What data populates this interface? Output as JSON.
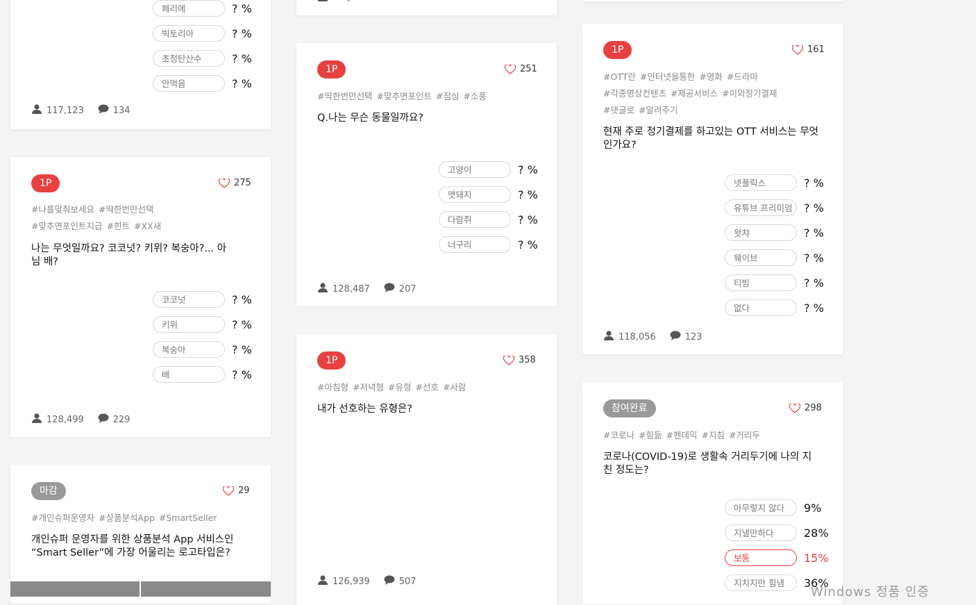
{
  "card1": {
    "options": [
      {
        "label": "페리에",
        "pct": "? %"
      },
      {
        "label": "빅토리아",
        "pct": "? %"
      },
      {
        "label": "초정탄산수",
        "pct": "? %"
      },
      {
        "label": "안먹음",
        "pct": "? %"
      }
    ],
    "participants": "117,123",
    "comments": "134"
  },
  "card2": {
    "badge": "1P",
    "likes": "275",
    "tags": [
      "#나를맞춰보세요",
      "#딱한번만선택",
      "#맞추면포인트지급",
      "#힌트",
      "#XX새"
    ],
    "question": "나는 무엇일까요? 코코넛? 키위? 복숭아?... 아님 배?",
    "options": [
      {
        "label": "코코넛",
        "pct": "? %"
      },
      {
        "label": "키위",
        "pct": "? %"
      },
      {
        "label": "복숭아",
        "pct": "? %"
      },
      {
        "label": "배",
        "pct": "? %"
      }
    ],
    "participants": "128,499",
    "comments": "229"
  },
  "card3": {
    "badge": "마감",
    "likes": "29",
    "tags": [
      "#개인슈퍼운영자",
      "#상품분석App",
      "#SmartSeller"
    ],
    "question": "개인슈퍼 운영자를 위한 상품분석 App 서비스인 “Smart Seller”에 가장 어울리는 로고타입은?"
  },
  "card4": {
    "badge": "1P",
    "likes": "251",
    "tags": [
      "#딱한번만선택",
      "#맞추면포인트",
      "#점심",
      "#소풍"
    ],
    "question": "Q.나는 무슨 동물일까요?",
    "options": [
      {
        "label": "고양이",
        "pct": "? %"
      },
      {
        "label": "맷돼지",
        "pct": "? %"
      },
      {
        "label": "다람쥐",
        "pct": "? %"
      },
      {
        "label": "너구리",
        "pct": "? %"
      }
    ],
    "participants": "128,487",
    "comments": "207"
  },
  "card5": {
    "badge": "1P",
    "likes": "358",
    "tags": [
      "#아침형",
      "#저녁형",
      "#유형",
      "#선호",
      "#사람"
    ],
    "question": "내가 선호하는 유형은?",
    "participants": "126,939",
    "comments": "507"
  },
  "card6": {
    "badge": "1P",
    "likes": "161",
    "tags": [
      "#OTT란",
      "#인터넷을통한",
      "#영화",
      "#드라마",
      "#각종영상컨텐츠",
      "#제공서비스",
      "#이외정기결제",
      "#댓글로",
      "#알려주기"
    ],
    "question": "현재 주로 정기결제를 하고있는 OTT 서비스는 무엇인가요?",
    "options": [
      {
        "label": "넷플릭스",
        "pct": "? %"
      },
      {
        "label": "유튜브 프리미엄",
        "pct": "? %"
      },
      {
        "label": "왓챠",
        "pct": "? %"
      },
      {
        "label": "웨이브",
        "pct": "? %"
      },
      {
        "label": "티빙",
        "pct": "? %"
      },
      {
        "label": "없다",
        "pct": "? %"
      }
    ],
    "participants": "118,056",
    "comments": "123"
  },
  "card7": {
    "badge": "참여완료",
    "likes": "298",
    "tags": [
      "#코로나",
      "#힘듦",
      "#펜데믹",
      "#지침",
      "#거리두"
    ],
    "question": "코로나(COVID-19)로 생활속 거리두기에 나의 지친 정도는?",
    "options": [
      {
        "label": "아무렇지 않다",
        "pct": "9%"
      },
      {
        "label": "지낼만하다",
        "pct": "28%"
      },
      {
        "label": "보통",
        "pct": "15%"
      },
      {
        "label": "지치지만 힘냄",
        "pct": "36%"
      }
    ]
  },
  "watermark": "Windows 정품 인증",
  "colors": {
    "accent": "#e84040",
    "badge_gray": "#999999",
    "background": "#f4f4f4"
  },
  "icons": {
    "like": "heart-icon",
    "participants": "user-icon",
    "comments": "comment-icon"
  }
}
